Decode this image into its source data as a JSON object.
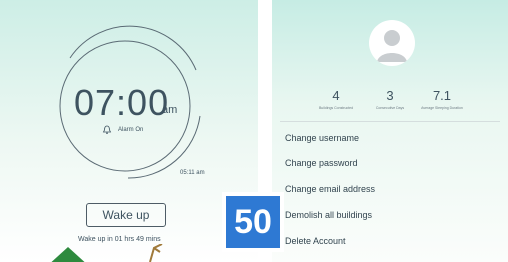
{
  "alarm_screen": {
    "time": "07:00",
    "ampm": "am",
    "alarm_status": "Alarm On",
    "wake_time": "05:11 am",
    "wake_button": "Wake up",
    "wake_in": "Wake up in 01 hrs 49 mins"
  },
  "profile_screen": {
    "stats": [
      {
        "value": "4",
        "label": "Buildings Constructed"
      },
      {
        "value": "3",
        "label": "Consecutive Days"
      },
      {
        "value": "7.1",
        "label": "Average Sleeping Duration"
      }
    ],
    "menu": [
      {
        "label": "Change username"
      },
      {
        "label": "Change password"
      },
      {
        "label": "Change email address"
      },
      {
        "label": "Demolish all buildings"
      },
      {
        "label": "Delete Account"
      }
    ]
  },
  "badge": {
    "number": "50"
  },
  "colors": {
    "accent_blue": "#2e79d3",
    "text": "#3e5360",
    "tree_green": "#2e8a3e"
  }
}
